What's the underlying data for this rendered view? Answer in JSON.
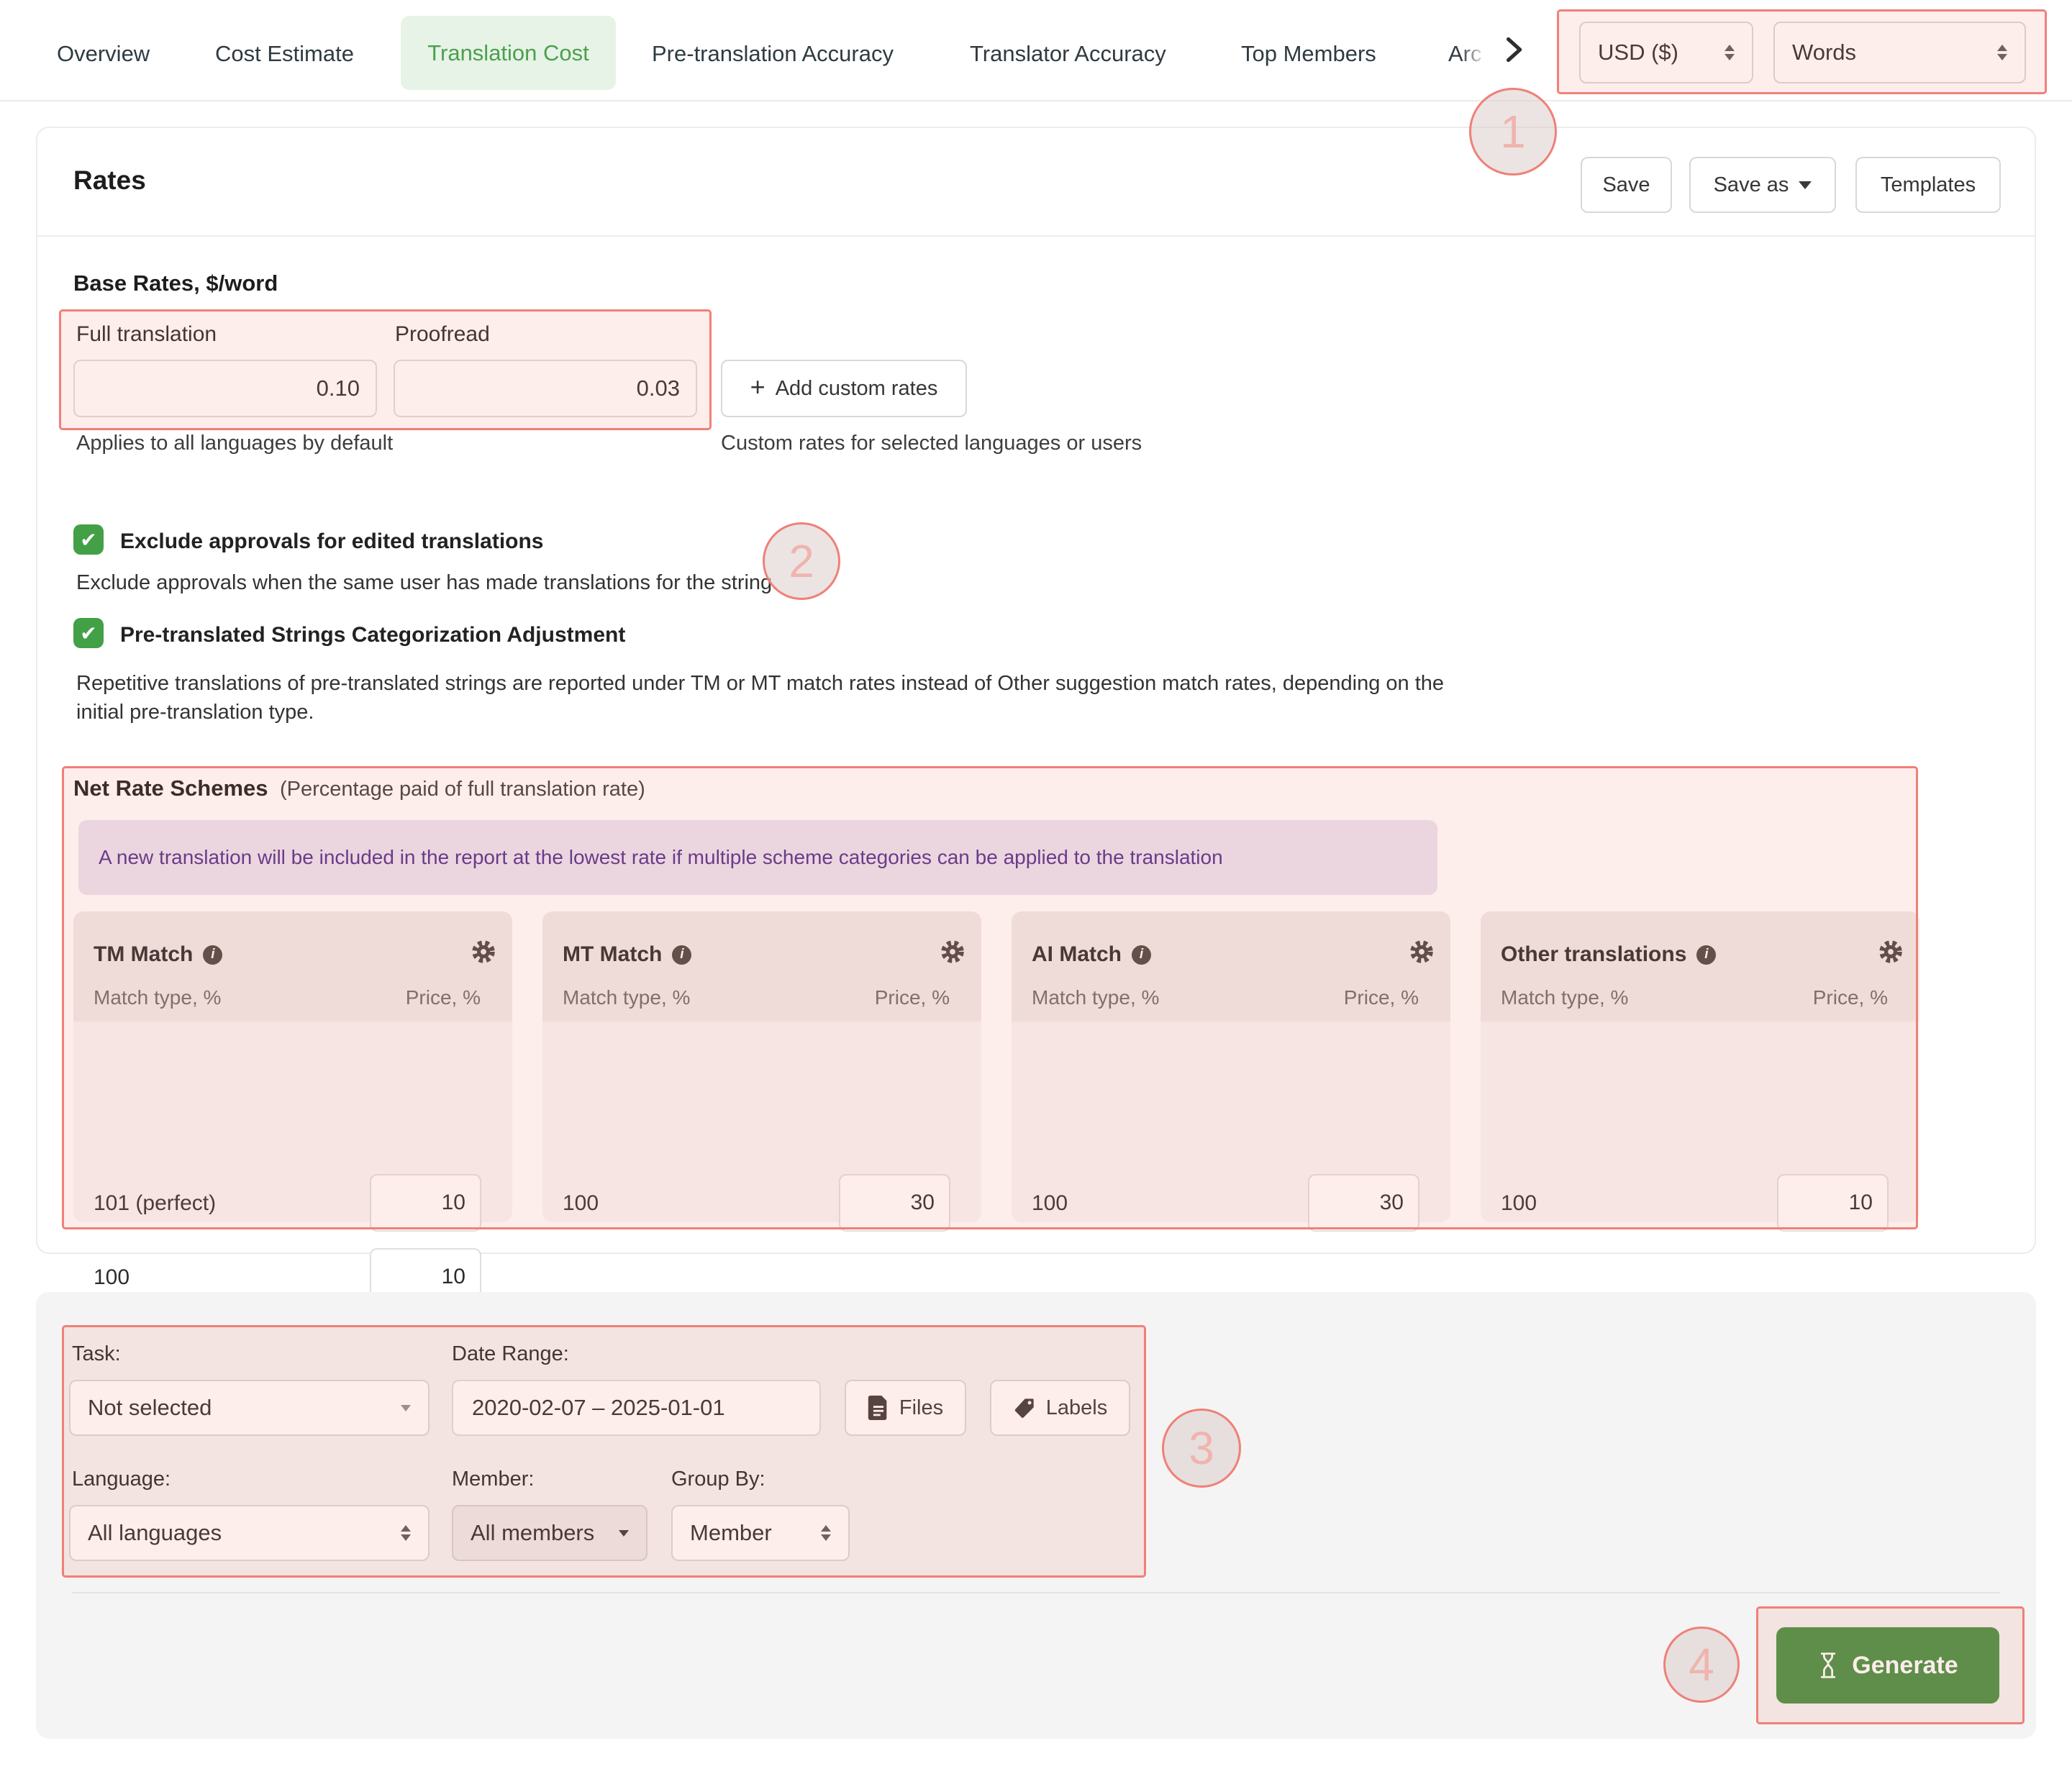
{
  "header": {
    "tabs": [
      {
        "label": "Overview",
        "active": false
      },
      {
        "label": "Cost Estimate",
        "active": false
      },
      {
        "label": "Translation Cost",
        "active": true
      },
      {
        "label": "Pre-translation Accuracy",
        "active": false
      },
      {
        "label": "Translator Accuracy",
        "active": false
      },
      {
        "label": "Top Members",
        "active": false
      },
      {
        "label": "Arc",
        "active": false,
        "truncated": true
      }
    ],
    "currency_select": "USD ($)",
    "units_select": "Words"
  },
  "rates_card": {
    "title": "Rates",
    "buttons": {
      "save": "Save",
      "save_as": "Save as",
      "templates": "Templates"
    },
    "base_rates": {
      "heading": "Base Rates, $/word",
      "fields": [
        {
          "label": "Full translation",
          "value": "0.10"
        },
        {
          "label": "Proofread",
          "value": "0.03"
        }
      ],
      "add_custom_button": "Add custom rates",
      "left_caption": "Applies to all languages by default",
      "right_caption": "Custom rates for selected languages or users"
    },
    "options": [
      {
        "label": "Exclude approvals for edited translations",
        "checked": true,
        "description": "Exclude approvals when the same user has made translations for the string."
      },
      {
        "label": "Pre-translated Strings Categorization Adjustment",
        "checked": true,
        "description": "Repetitive translations of pre-translated strings are reported under TM or MT match rates instead of Other suggestion match rates, depending on the initial pre-translation type."
      }
    ],
    "net_rate_schemes": {
      "title": "Net Rate Schemes",
      "subtitle": "(Percentage paid of full translation rate)",
      "banner": "A new translation will be included in the report at the lowest rate if multiple scheme categories can be applied to the translation",
      "columns": {
        "match_type": "Match type, %",
        "price": "Price, %"
      },
      "cards": [
        {
          "title": "TM Match",
          "rows": [
            {
              "match_type": "101 (perfect)",
              "price": "10"
            },
            {
              "match_type": "100",
              "price": "10"
            }
          ]
        },
        {
          "title": "MT Match",
          "rows": [
            {
              "match_type": "100",
              "price": "30"
            }
          ]
        },
        {
          "title": "AI Match",
          "rows": [
            {
              "match_type": "100",
              "price": "30"
            }
          ]
        },
        {
          "title": "Other translations",
          "rows": [
            {
              "match_type": "100",
              "price": "10"
            }
          ]
        }
      ]
    }
  },
  "filters_panel": {
    "task": {
      "label": "Task:",
      "value": "Not selected"
    },
    "date_range": {
      "label": "Date Range:",
      "value": "2020-02-07 – 2025-01-01"
    },
    "files_button": "Files",
    "labels_button": "Labels",
    "language": {
      "label": "Language:",
      "value": "All languages"
    },
    "member": {
      "label": "Member:",
      "value": "All members"
    },
    "group_by": {
      "label": "Group By:",
      "value": "Member"
    },
    "generate_button": "Generate"
  },
  "annotations": {
    "circles": [
      "1",
      "2",
      "3",
      "4"
    ]
  },
  "colors": {
    "accent_green": "#459042",
    "active_tab_green": "#4c9f4f",
    "checkbox_green": "#43a047",
    "annotation_red": "#ef8078",
    "banner_purple_text": "#532e8c",
    "banner_bg": "#eae4f1"
  }
}
